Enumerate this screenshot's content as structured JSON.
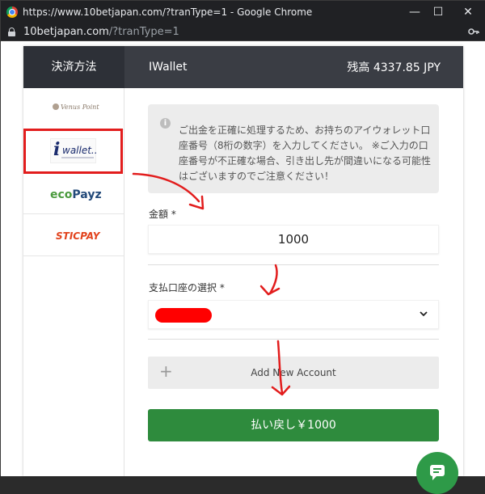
{
  "window": {
    "title": "https://www.10betjapan.com/?tranType=1 - Google Chrome",
    "minimize": "—",
    "maximize": "☐",
    "close": "✕"
  },
  "address": {
    "host": "10betjapan.com",
    "path": "/?tranType=1",
    "key_icon": "key-icon"
  },
  "header": {
    "left": "決済方法",
    "title": "IWallet",
    "balance": "残高 4337.85 JPY"
  },
  "methods": [
    {
      "name": "Venus Point",
      "icon": "venus-point-logo"
    },
    {
      "name": "wallet..",
      "icon": "iwallet-logo",
      "selected": true
    },
    {
      "name_eco": "eco",
      "name_payz": "Payz",
      "icon": "ecopayz-logo"
    },
    {
      "name": "STICPAY",
      "icon": "sticpay-logo"
    }
  ],
  "info": {
    "icon": "info-icon",
    "text": "ご出金を正確に処理するため、お持ちのアイウォレット口座番号（8桁の数字）を入力してください。 ※ご入力の口座番号が不正確な場合、引き出し先が間違いになる可能性はございますのでご注意ください！"
  },
  "form": {
    "amount_label": "金額 *",
    "amount_value": "1000",
    "account_label": "支払口座の選択 *",
    "add_account_label": "Add New Account",
    "submit_label": "払い戻し￥1000"
  },
  "colors": {
    "accent": "#2e8b3d",
    "annotation": "#e21d1d",
    "header_dark": "#2d3037"
  }
}
